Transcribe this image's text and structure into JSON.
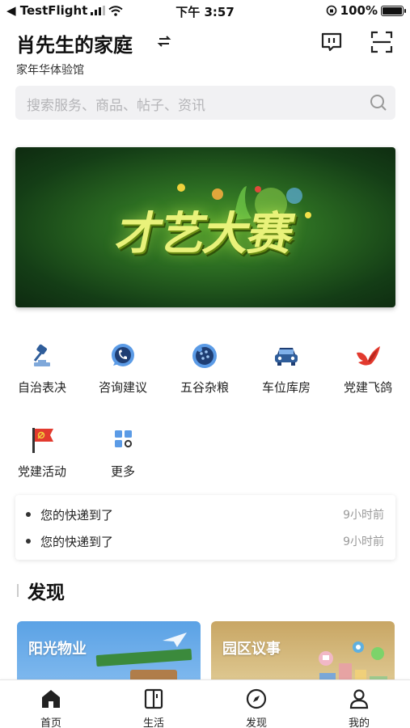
{
  "status_bar": {
    "back_app": "◀ TestFlight",
    "time": "下午 3:57",
    "battery": "100%",
    "battery_level": 1.0
  },
  "header": {
    "title": "肖先生的家庭",
    "subtitle": "家年华体验馆",
    "icons": [
      "switch-icon",
      "message-icon",
      "scan-icon"
    ]
  },
  "search": {
    "placeholder": "搜索服务、商品、帖子、资讯"
  },
  "banner": {
    "text": "才艺大赛"
  },
  "quick_actions": [
    {
      "label": "自治表决",
      "icon": "gavel-icon"
    },
    {
      "label": "咨询建议",
      "icon": "phone-bubble-icon"
    },
    {
      "label": "五谷杂粮",
      "icon": "grain-icon"
    },
    {
      "label": "车位库房",
      "icon": "car-icon"
    },
    {
      "label": "党建飞鸽",
      "icon": "dove-icon"
    },
    {
      "label": "党建活动",
      "icon": "party-flag-icon"
    },
    {
      "label": "更多",
      "icon": "more-grid-icon"
    }
  ],
  "notices": [
    {
      "text": "您的快递到了",
      "time": "9小时前"
    },
    {
      "text": "您的快递到了",
      "time": "9小时前"
    }
  ],
  "discover": {
    "title": "发现",
    "cards": [
      {
        "title": "阳光物业",
        "color": "#5ba2e5"
      },
      {
        "title": "园区议事",
        "color": "#c8a664"
      }
    ]
  },
  "tabbar": {
    "tabs": [
      {
        "label": "首页",
        "icon": "home-icon"
      },
      {
        "label": "生活",
        "icon": "life-icon"
      },
      {
        "label": "发现",
        "icon": "compass-icon"
      },
      {
        "label": "我的",
        "icon": "user-icon"
      }
    ]
  },
  "colors": {
    "accent_red": "#e23a2e",
    "accent_blue": "#2f7fd8",
    "banner_green": "#2c6d22"
  }
}
